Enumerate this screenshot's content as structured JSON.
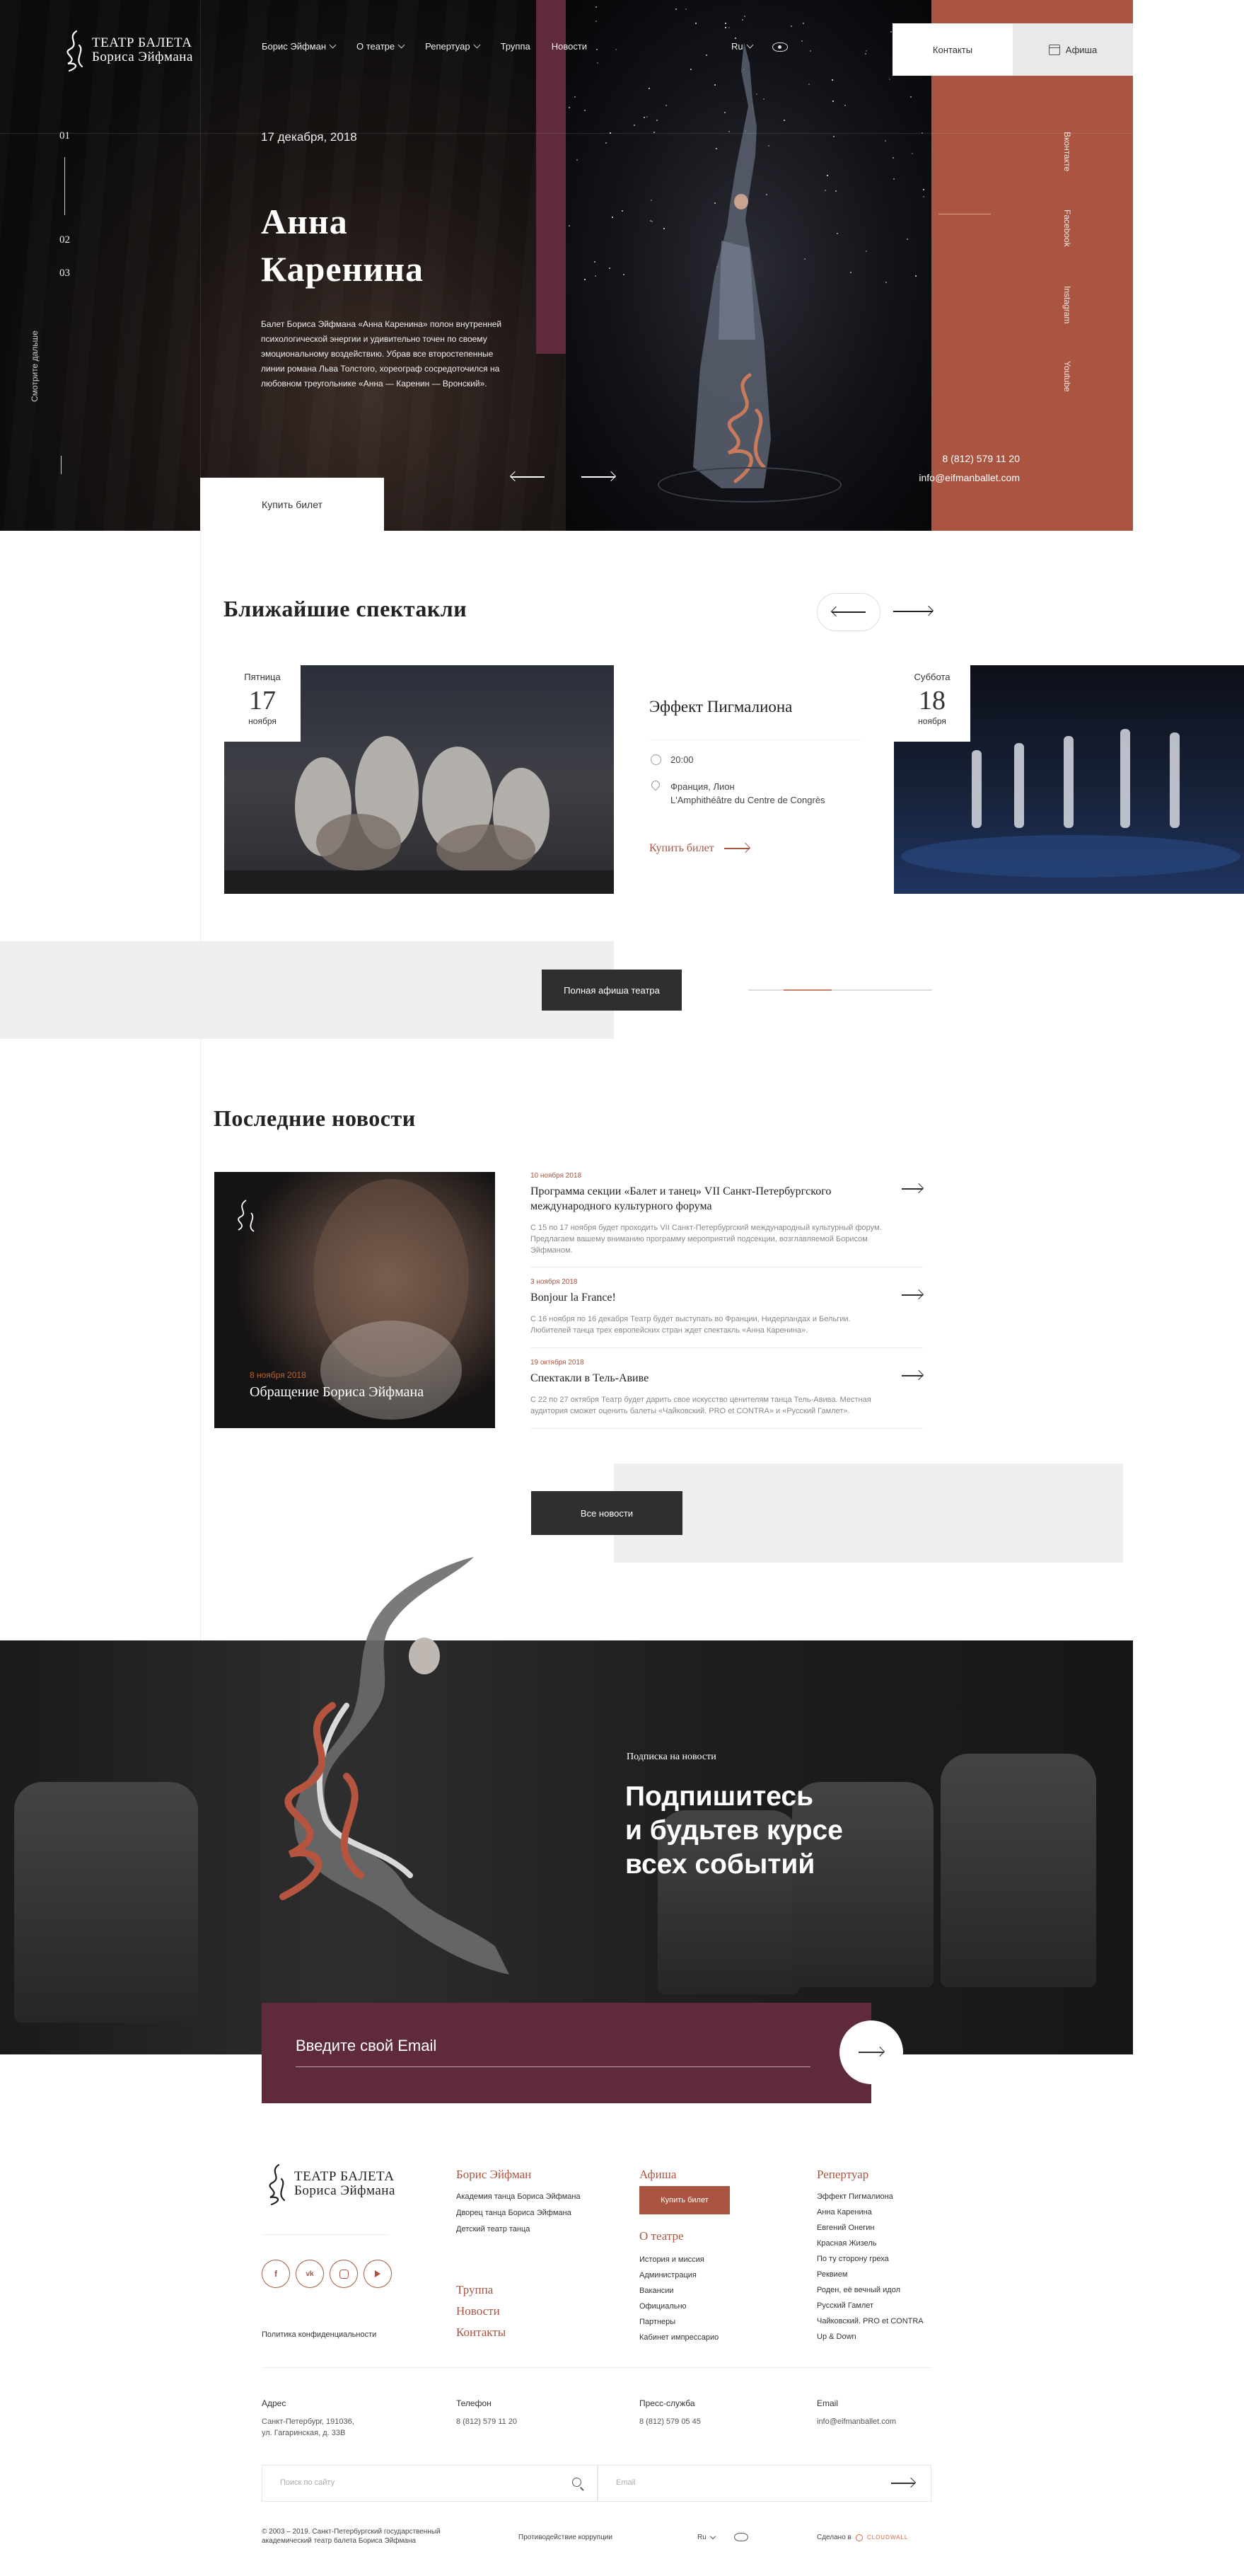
{
  "header": {
    "logo_line1": "ТЕАТР БАЛЕТА",
    "logo_line2": "Бориса Эйфмана",
    "nav": [
      {
        "label": "Борис Эйфман",
        "has_dropdown": true
      },
      {
        "label": "О театре",
        "has_dropdown": true
      },
      {
        "label": "Репертуар",
        "has_dropdown": true
      },
      {
        "label": "Труппа",
        "has_dropdown": false
      },
      {
        "label": "Новости",
        "has_dropdown": false
      }
    ],
    "lang": "Ru",
    "contacts_label": "Контакты",
    "afisha_label": "Афиша"
  },
  "hero": {
    "slides": [
      "01",
      "02",
      "03"
    ],
    "scroll_hint": "Смотрите дальше",
    "date": "17 декабря, 2018",
    "title_line1": "Анна",
    "title_line2": "Каренина",
    "description": "Балет Бориса Эйфмана «Анна Каренина» полон внутренней психологической энергии и удивительно точен по своему эмоциональному воздействию. Убрав все второстепенные линии романа Льва Толстого, хореограф сосредоточился на любовном треугольнике «Анна — Каренин — Вронский».",
    "buy_label": "Купить билет",
    "social": [
      "Вконтакте",
      "Facebook",
      "Instagram",
      "Youtube"
    ],
    "phone": "8 (812) 579 11 20",
    "email": "info@eifmanballet.com"
  },
  "upcoming": {
    "title": "Ближайшие спектакли",
    "left_date": {
      "weekday": "Пятница",
      "day": "17",
      "month": "ноября"
    },
    "card": {
      "title": "Эффект Пигмалиона",
      "time": "20:00",
      "place_line1": "Франция, Лион",
      "place_line2": "L'Amphithéâtre du Centre de Congrès",
      "buy_label": "Купить билет"
    },
    "right_date": {
      "weekday": "Суббота",
      "day": "18",
      "month": "ноября"
    },
    "full_schedule_label": "Полная афиша театра",
    "progress_fraction": 0.26
  },
  "news": {
    "title": "Последние новости",
    "feature": {
      "date": "8 ноября 2018",
      "title": "Обращение Бориса Эйфмана"
    },
    "items": [
      {
        "date": "10 ноября 2018",
        "title": "Программа секции «Балет и танец» VII Санкт-Петербургского международного культурного форума",
        "text": "С 15 по 17 ноября будет проходить VII Санкт-Петербургский международный культурный форум. Предлагаем вашему вниманию программу мероприятий подсекции, возглавляемой Борисом Эйфманом."
      },
      {
        "date": "3 ноября 2018",
        "title": "Bonjour la France!",
        "text": "С 16 ноября по 16 декабря Театр будет выступать во Франции, Нидерландах и Бельгии. Любителей танца трех европейских стран ждет спектакль «Анна Каренина»."
      },
      {
        "date": "19 октября 2018",
        "title": "Спектакли в Тель-Авиве",
        "text": "С 22 по 27 октября Театр будет дарить свое искусство ценителям танца Тель-Авива. Местная аудитория сможет оценить балеты «Чайковский. PRO et CONTRA» и «Русский Гамлет»."
      }
    ],
    "all_label": "Все новости"
  },
  "subscribe": {
    "label": "Подписка на новости",
    "title_line1": "Подпишитесь",
    "title_line2": "и будьтев курсе",
    "title_line3": "всех событий",
    "placeholder": "Введите свой Email"
  },
  "footer": {
    "logo_line1": "ТЕАТР БАЛЕТА",
    "logo_line2": "Бориса Эйфмана",
    "col1_head": "Борис Эйфман",
    "col1_links": [
      "Академия танца Бориса Эйфмана",
      "Дворец танца Бориса Эйфмана",
      "Детский театр танца"
    ],
    "col1_big": [
      "Труппа",
      "Новости",
      "Контакты"
    ],
    "col2_head": "Афиша",
    "col2_buy": "Купить билет",
    "col2_head2": "О театре",
    "col2_links": [
      "История и миссия",
      "Администрация",
      "Вакансии",
      "Официально",
      "Партнеры",
      "Кабинет импрессарио"
    ],
    "col3_head": "Репертуар",
    "col3_links": [
      "Эффект Пигмалиона",
      "Анна Каренина",
      "Евгений Онегин",
      "Красная Жизель",
      "По ту сторону греха",
      "Реквием",
      "Роден, её вечный идол",
      "Русский Гамлет",
      "Чайковский. PRO et CONTRA",
      "Up & Down"
    ],
    "social_icons": [
      "f",
      "vk",
      "ig",
      "yt"
    ],
    "privacy": "Политика конфиденциальности",
    "address_label": "Адрес",
    "address_value_line1": "Санкт-Петербург, 191036,",
    "address_value_line2": "ул. Гагаринская, д. 33В",
    "phone_label": "Телефон",
    "phone_value": "8 (812) 579 11 20",
    "press_label": "Пресс-служба",
    "press_value": "8 (812) 579 05 45",
    "email_label": "Email",
    "email_value": "info@eifmanballet.com",
    "search_placeholder": "Поиск по сайту",
    "email_placeholder": "Email",
    "copyright_line1": "© 2003 – 2019. Санкт-Петербургский государственный",
    "copyright_line2": "академический театр балета Бориса Эйфмана",
    "anticorruption": "Противодействие коррупции",
    "lang": "Ru",
    "made_by": "Сделано в",
    "studio": "CLOUDWALL"
  },
  "colors": {
    "accent": "#a95542",
    "plum": "#5e2a3c",
    "dark": "#0b0b0c"
  }
}
